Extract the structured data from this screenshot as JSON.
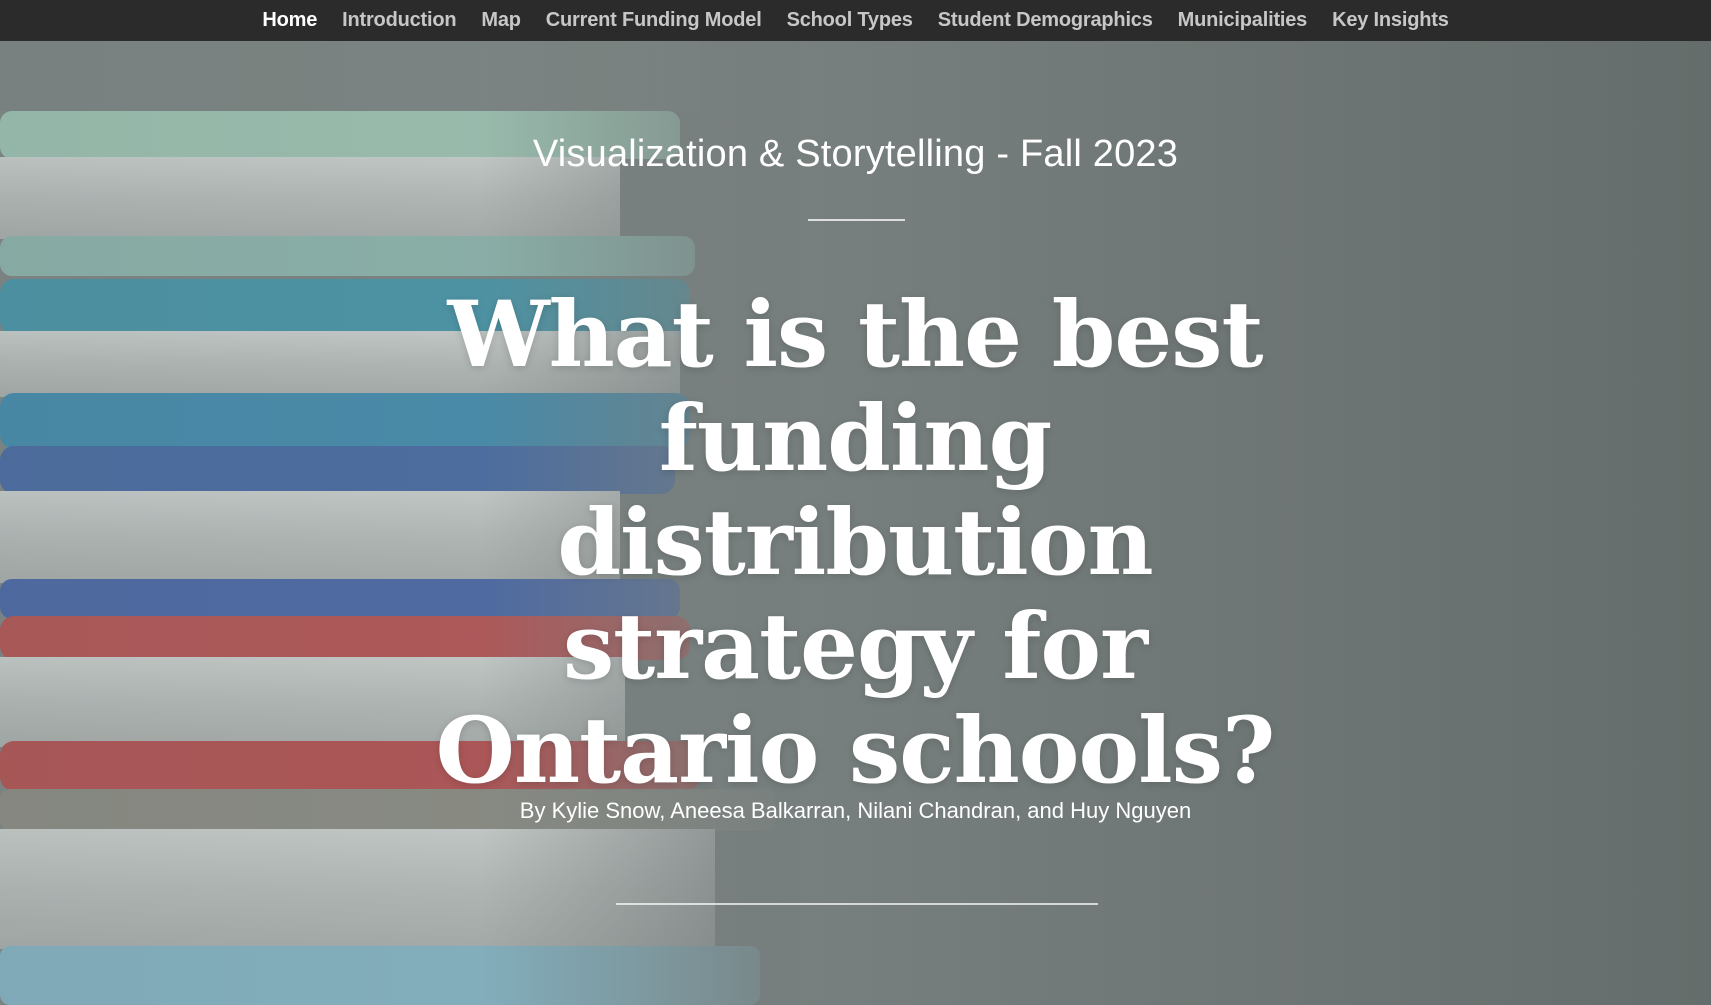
{
  "nav": {
    "items": [
      {
        "label": "Home",
        "active": true
      },
      {
        "label": "Introduction"
      },
      {
        "label": "Map"
      },
      {
        "label": "Current Funding Model"
      },
      {
        "label": "School Types"
      },
      {
        "label": "Student Demographics"
      },
      {
        "label": "Municipalities"
      },
      {
        "label": "Key Insights"
      }
    ]
  },
  "hero": {
    "course": "Visualization & Storytelling - Fall 2023",
    "headline_lines": [
      "What is the best",
      "funding",
      "distribution",
      "strategy for",
      "Ontario schools?"
    ],
    "byline": "By Kylie Snow, Aneesa Balkarran, Nilani Chandran, and Huy Nguyen",
    "background": "stack of books"
  },
  "colors": {
    "nav_bg": "#2b2b2b",
    "nav_text": "#c7c7c7",
    "nav_active": "#ffffff",
    "hero_bg": "#7a8281",
    "text": "#ffffff"
  }
}
